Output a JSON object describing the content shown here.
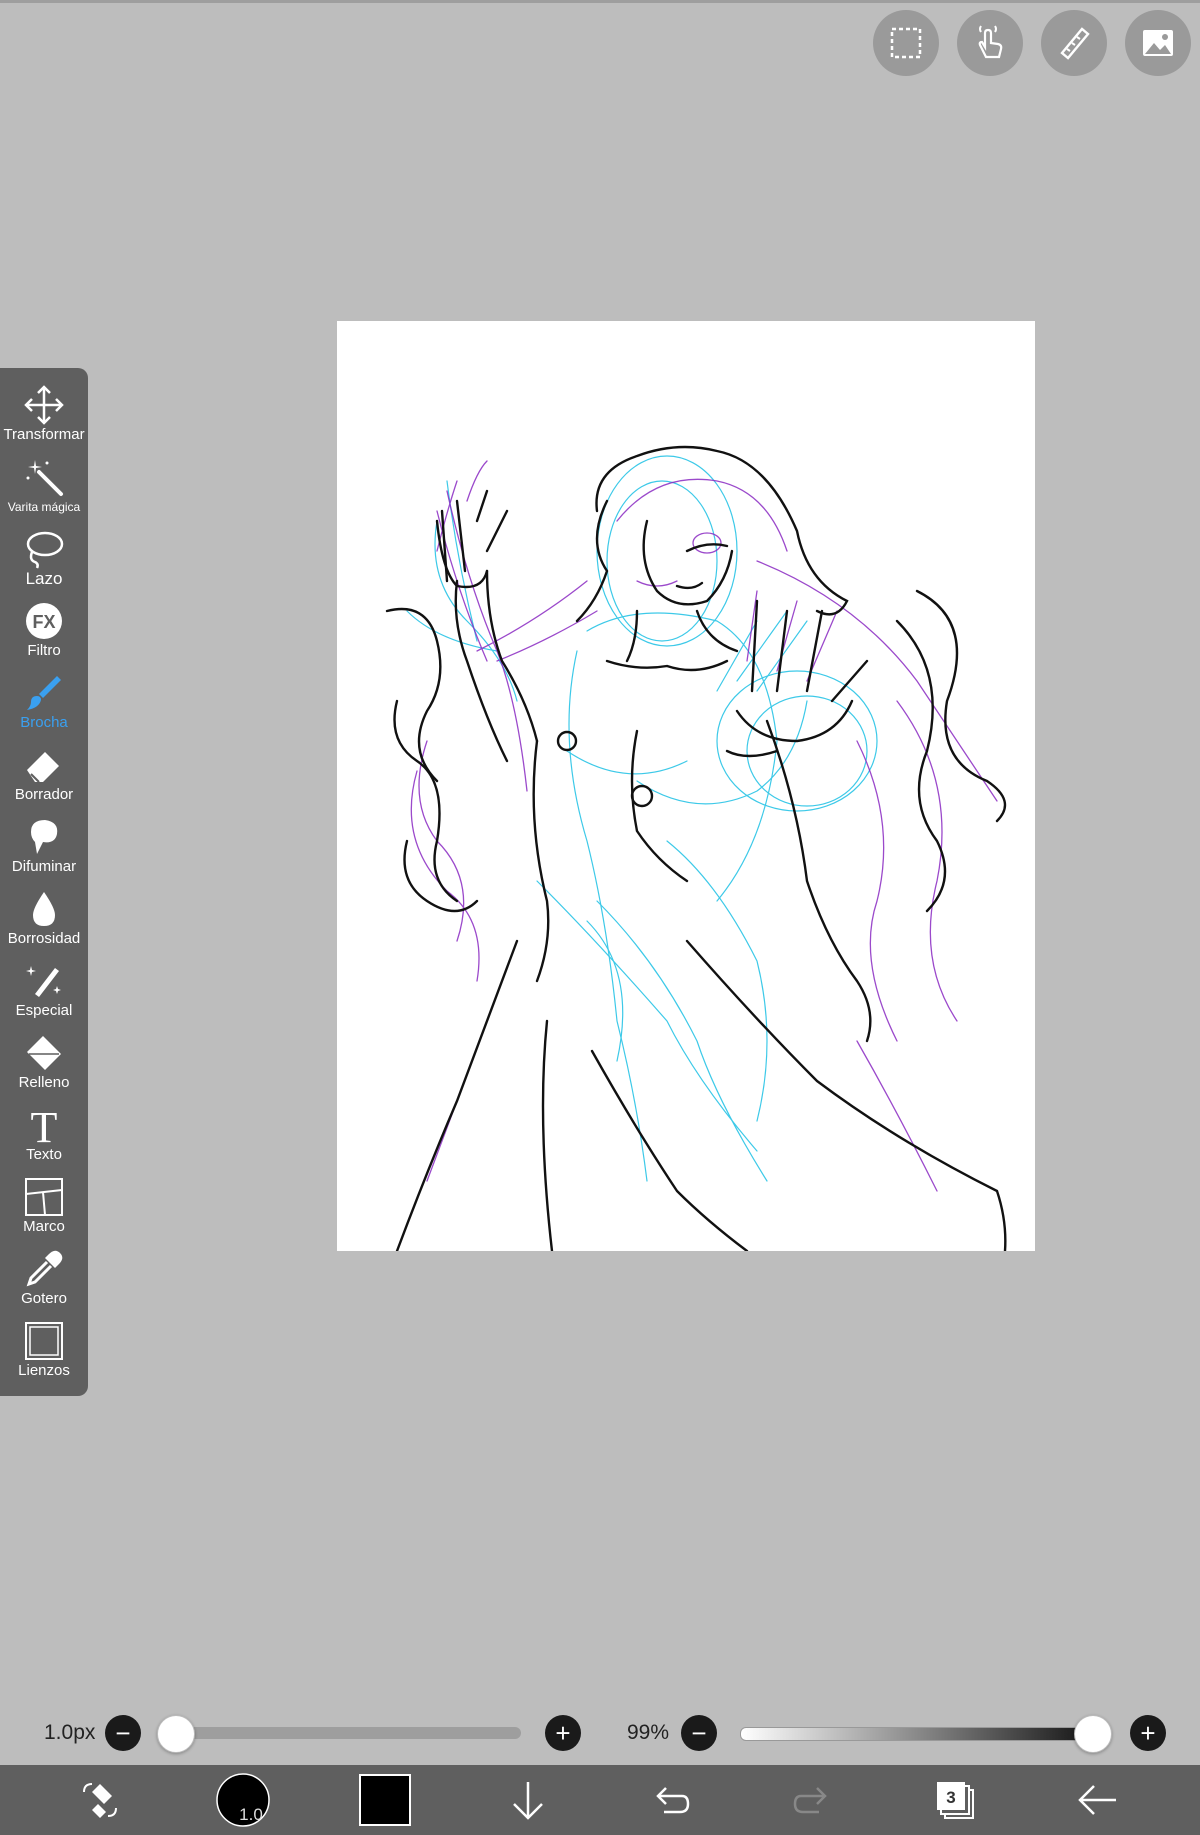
{
  "app": {
    "top_buttons": [
      {
        "icon": "selection-icon"
      },
      {
        "icon": "hand-gesture-icon"
      },
      {
        "icon": "ruler-icon"
      },
      {
        "icon": "gallery-icon"
      }
    ]
  },
  "toolbar": {
    "tools": [
      {
        "label": "Transformar",
        "icon": "move-arrows-icon"
      },
      {
        "label": "Varita mágica",
        "icon": "magic-wand-icon"
      },
      {
        "label": "Lazo",
        "icon": "lasso-icon"
      },
      {
        "label": "Filtro",
        "icon": "fx-icon"
      },
      {
        "label": "Brocha",
        "icon": "brush-icon",
        "active": true
      },
      {
        "label": "Borrador",
        "icon": "eraser-icon"
      },
      {
        "label": "Difuminar",
        "icon": "smudge-icon"
      },
      {
        "label": "Borrosidad",
        "icon": "blur-drop-icon"
      },
      {
        "label": "Especial",
        "icon": "special-brush-icon"
      },
      {
        "label": "Relleno",
        "icon": "fill-bucket-icon"
      },
      {
        "label": "Texto",
        "icon": "text-icon"
      },
      {
        "label": "Marco",
        "icon": "frame-icon"
      },
      {
        "label": "Gotero",
        "icon": "eyedropper-icon"
      },
      {
        "label": "Lienzos",
        "icon": "canvas-icon"
      }
    ],
    "fx_text": "FX",
    "text_icon_glyph": "T"
  },
  "sliders": {
    "size_label": "1.0px",
    "size_value": 0.0,
    "opacity_label": "99%",
    "opacity_value": 0.99,
    "minus": "−",
    "plus": "+"
  },
  "bottom": {
    "brush_size_label": "1.0",
    "color_swatch": "#000000",
    "layers_count": "3",
    "icons": [
      "brush-eraser-swap-icon",
      "brush-size-icon",
      "color-swatch",
      "down-arrow-icon",
      "undo-icon",
      "redo-icon",
      "layers-icon",
      "back-arrow-icon"
    ]
  },
  "colors": {
    "accent": "#3aa0f0",
    "toolbar_bg": "#5f5f5f",
    "workspace_bg": "#bdbdbd",
    "sketch_cyan": "#29c4e6",
    "sketch_purple": "#8a2ac2"
  }
}
